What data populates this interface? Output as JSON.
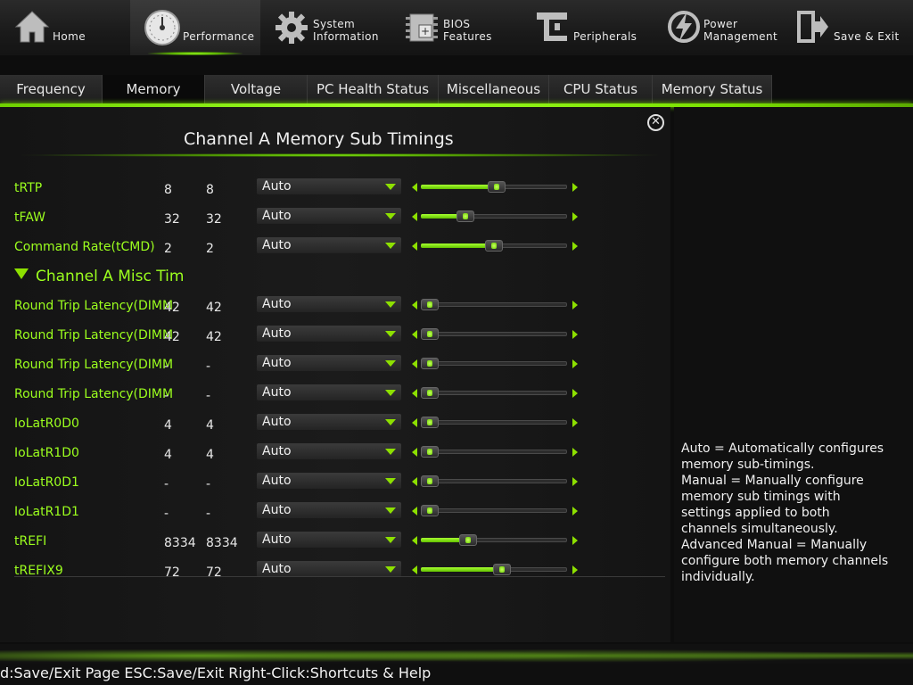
{
  "top_nav": [
    {
      "label": "Home",
      "icon": "home-icon",
      "active": false
    },
    {
      "label": "Performance",
      "icon": "gauge-icon",
      "active": true
    },
    {
      "label": "System\nInformation",
      "icon": "gear-icon",
      "active": false
    },
    {
      "label": "BIOS\nFeatures",
      "icon": "bios-chip-icon",
      "active": false
    },
    {
      "label": "Peripherals",
      "icon": "peripherals-icon",
      "active": false
    },
    {
      "label": "Power\nManagement",
      "icon": "power-bolt-icon",
      "active": false
    },
    {
      "label": "Save & Exit",
      "icon": "exit-door-icon",
      "active": false
    }
  ],
  "sub_tabs": [
    {
      "label": "Frequency",
      "active": false
    },
    {
      "label": "Memory",
      "active": true
    },
    {
      "label": "Voltage",
      "active": false
    },
    {
      "label": "PC Health Status",
      "active": false
    },
    {
      "label": "Miscellaneous",
      "active": false
    },
    {
      "label": "CPU Status",
      "active": false
    },
    {
      "label": "Memory Status",
      "active": false
    }
  ],
  "panel": {
    "title": "Channel A Memory Sub Timings",
    "close_icon": "close-circle-icon",
    "section_header": "Channel A Misc Tim",
    "rows_before_section": [
      {
        "name": "tRTP",
        "v1": "8",
        "v2": "8",
        "select": "Auto",
        "level": 0.52
      },
      {
        "name": "tFAW",
        "v1": "32",
        "v2": "32",
        "select": "Auto",
        "level": 0.28
      },
      {
        "name": "Command Rate(tCMD)",
        "v1": "2",
        "v2": "2",
        "select": "Auto",
        "level": 0.5
      }
    ],
    "rows_after_section": [
      {
        "name": "Round Trip Latency(DIMM",
        "v1": "42",
        "v2": "42",
        "select": "Auto",
        "level": 0.0
      },
      {
        "name": "Round Trip Latency(DIMM",
        "v1": "42",
        "v2": "42",
        "select": "Auto",
        "level": 0.0
      },
      {
        "name": "Round Trip Latency(DIMM",
        "v1": "-",
        "v2": "-",
        "select": "Auto",
        "level": 0.0
      },
      {
        "name": "Round Trip Latency(DIMM",
        "v1": "-",
        "v2": "-",
        "select": "Auto",
        "level": 0.0
      },
      {
        "name": "IoLatR0D0",
        "v1": "4",
        "v2": "4",
        "select": "Auto",
        "level": 0.0
      },
      {
        "name": "IoLatR1D0",
        "v1": "4",
        "v2": "4",
        "select": "Auto",
        "level": 0.0
      },
      {
        "name": "IoLatR0D1",
        "v1": "-",
        "v2": "-",
        "select": "Auto",
        "level": 0.0
      },
      {
        "name": "IoLatR1D1",
        "v1": "-",
        "v2": "-",
        "select": "Auto",
        "level": 0.0
      },
      {
        "name": "tREFI",
        "v1": "8334",
        "v2": "8334",
        "select": "Auto",
        "level": 0.3
      },
      {
        "name": "tREFIX9",
        "v1": "72",
        "v2": "72",
        "select": "Auto",
        "level": 0.56
      }
    ]
  },
  "help": {
    "text": "Auto = Automatically configures\nmemory sub-timings.\nManual = Manually configure\nmemory sub timings with\nsettings applied to both\nchannels simultaneously.\nAdvanced Manual = Manually\nconfigure both memory channels\nindividually."
  },
  "footer": {
    "text": "d:Save/Exit Page ESC:Save/Exit Right-Click:Shortcuts & Help"
  },
  "colors": {
    "accent": "#8de000",
    "label_green": "#9cff1e",
    "background": "#0d0d0d"
  }
}
